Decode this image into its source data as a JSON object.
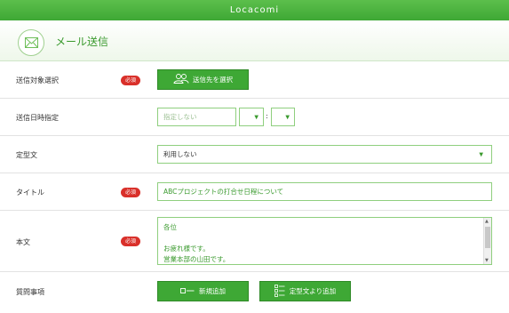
{
  "app_title": "Locacomi",
  "section": {
    "title": "メール送信",
    "icon": "mail-icon"
  },
  "required_badge": "必須",
  "recipients": {
    "label": "送信対象選択",
    "button": "送信先を選択",
    "icon": "people-icon"
  },
  "datetime": {
    "label": "送信日時指定",
    "date_placeholder": "指定しない",
    "separator": ":",
    "arrow": "▼"
  },
  "template": {
    "label": "定型文",
    "value": "利用しない",
    "arrow": "▼"
  },
  "title_field": {
    "label": "タイトル",
    "value": "ABCプロジェクトの打合せ日程について"
  },
  "body": {
    "label": "本文",
    "lines": [
      "各位",
      "",
      "お疲れ様です。",
      "営業本部の山田です。"
    ]
  },
  "questions": {
    "label": "質問事項",
    "new_button": "新規追加",
    "template_button": "定型文より追加"
  },
  "colors": {
    "accent": "#3ea835",
    "required": "#d9302a"
  }
}
